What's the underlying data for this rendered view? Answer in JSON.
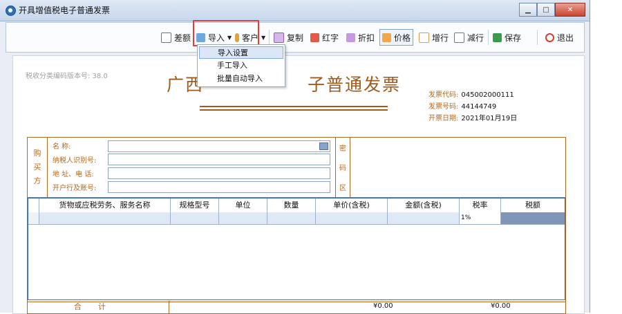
{
  "window": {
    "title": "开具增值税电子普通发票"
  },
  "toolbar": {
    "diff": "差额",
    "import": "导入",
    "customer": "客户",
    "copy": "复制",
    "red": "红字",
    "discount": "折扣",
    "price": "价格",
    "add_row": "增行",
    "del_row": "减行",
    "save": "保存",
    "exit": "退出"
  },
  "dropdown": {
    "items": [
      "导入设置",
      "手工导入",
      "批量自动导入"
    ]
  },
  "invoice": {
    "version_label": "税收分类编码版本号: 38.0",
    "title_left": "广西",
    "title_right": "子普通发票",
    "code_label": "发票代码:",
    "code_value": "045002000111",
    "number_label": "发票号码:",
    "number_value": "44144749",
    "date_label": "开票日期:",
    "date_value": "2021年01月19日"
  },
  "buyer": {
    "section_label": [
      "购",
      "买",
      "方"
    ],
    "name_label": "名        称:",
    "taxid_label": "纳税人识别号:",
    "address_label": "地 址、电 话:",
    "bank_label": "开户行及账号:",
    "code_area": [
      "密",
      "码",
      "区"
    ]
  },
  "table": {
    "headers": [
      "货物或应税劳务、服务名称",
      "规格型号",
      "单位",
      "数量",
      "单价(含税)",
      "金额(含税)",
      "税率",
      "税额"
    ],
    "row1_rate": "1%"
  },
  "total": {
    "label": "合计",
    "amount": "¥0.00",
    "tax": "¥0.00"
  },
  "colors": {
    "accent": "#a05a1c",
    "highlight": "#e23b3b"
  }
}
